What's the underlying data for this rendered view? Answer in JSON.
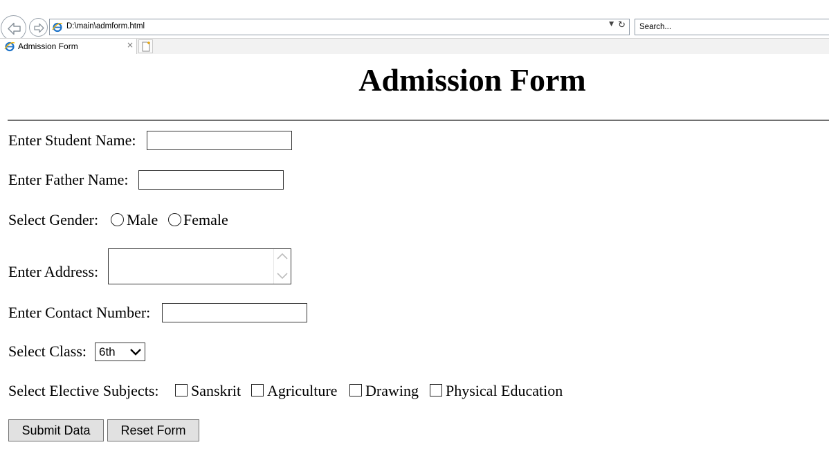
{
  "browser": {
    "url": "D:\\main\\admform.html",
    "search_placeholder": "Search...",
    "tab_title": "Admission Form",
    "tab_close": "×"
  },
  "form": {
    "title": "Admission Form",
    "student_name_label": "Enter Student Name:",
    "father_name_label": "Enter Father Name:",
    "gender_label": "Select Gender:",
    "gender_options": [
      "Male",
      "Female"
    ],
    "address_label": "Enter Address:",
    "contact_label": "Enter Contact Number:",
    "class_label": "Select Class:",
    "class_selected": "6th",
    "subjects_label": "Select Elective Subjects:",
    "subjects": [
      "Sanskrit",
      "Agriculture",
      "Drawing",
      "Physical Education"
    ],
    "submit_label": "Submit Data",
    "reset_label": "Reset Form"
  }
}
